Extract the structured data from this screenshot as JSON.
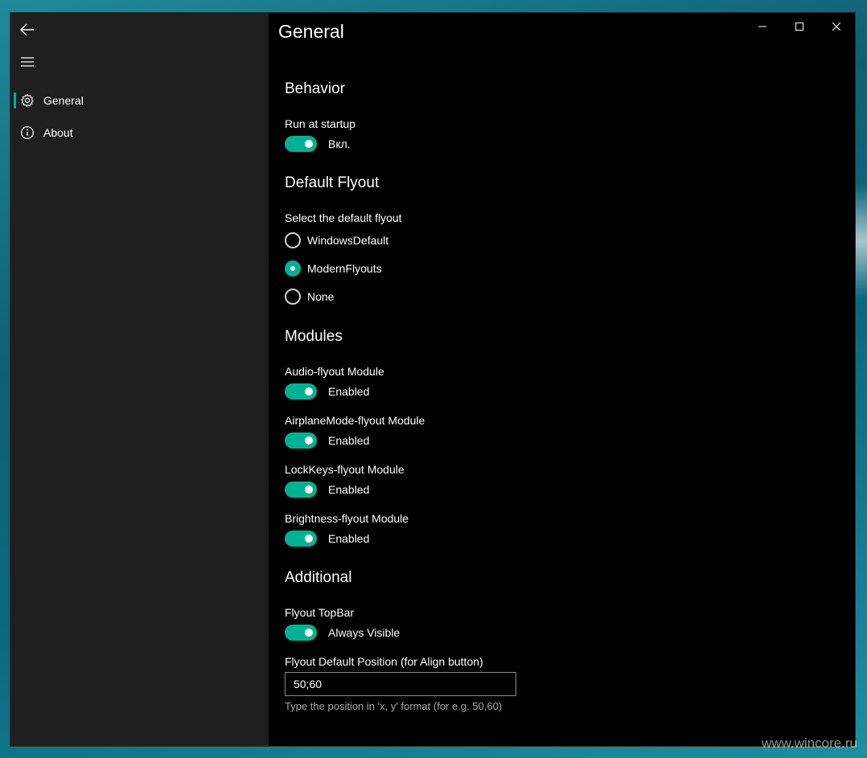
{
  "window": {
    "title": "General"
  },
  "sidebar": {
    "back_icon": "back-arrow-icon",
    "menu_icon": "hamburger-icon",
    "items": [
      {
        "label": "General",
        "icon": "gear-icon",
        "selected": true
      },
      {
        "label": "About",
        "icon": "info-icon",
        "selected": false
      }
    ]
  },
  "caption": {
    "minimize_icon": "minimize-icon",
    "maximize_icon": "maximize-icon",
    "close_icon": "close-icon"
  },
  "behavior": {
    "title": "Behavior",
    "run_at_startup": {
      "label": "Run at startup",
      "state": "Вкл.",
      "on": true
    }
  },
  "default_flyout": {
    "title": "Default Flyout",
    "label": "Select the default flyout",
    "options": [
      {
        "label": "WindowsDefault",
        "checked": false
      },
      {
        "label": "ModernFlyouts",
        "checked": true
      },
      {
        "label": "None",
        "checked": false
      }
    ]
  },
  "modules": {
    "title": "Modules",
    "items": [
      {
        "label": "Audio-flyout Module",
        "state": "Enabled",
        "on": true
      },
      {
        "label": "AirplaneMode-flyout Module",
        "state": "Enabled",
        "on": true
      },
      {
        "label": "LockKeys-flyout Module",
        "state": "Enabled",
        "on": true
      },
      {
        "label": "Brightness-flyout Module",
        "state": "Enabled",
        "on": true
      }
    ]
  },
  "additional": {
    "title": "Additional",
    "topbar": {
      "label": "Flyout TopBar",
      "state": "Always Visible",
      "on": true
    },
    "position": {
      "label": "Flyout Default Position (for Align button)",
      "value": "50;60",
      "hint": "Type the position in 'x, y' format (for e.g. 50,60)"
    }
  },
  "colors": {
    "accent": "#00b294",
    "sidebar_bg": "#1f1f1f",
    "content_bg": "#000000"
  },
  "watermark": "www.wincore.ru"
}
